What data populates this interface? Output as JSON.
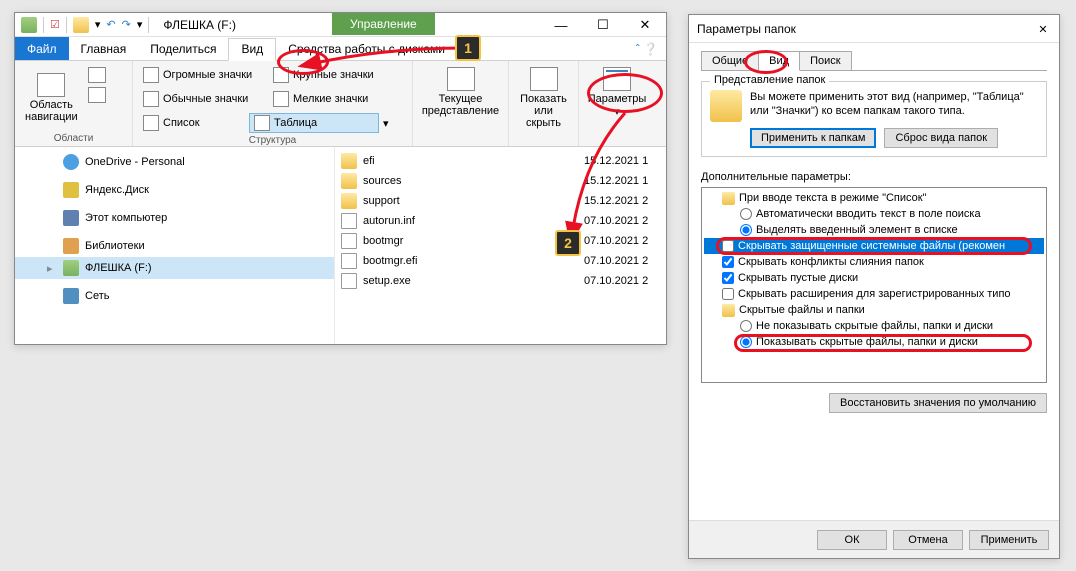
{
  "explorer": {
    "title": "ФЛЕШКА (F:)",
    "manage": "Управление",
    "win": {
      "min": "—",
      "max": "☐",
      "close": "✕"
    },
    "tabs": {
      "file": "Файл",
      "home": "Главная",
      "share": "Поделиться",
      "view": "Вид",
      "tools": "Средства работы с дисками"
    },
    "ribbon": {
      "panes": {
        "nav": "Область\nнавигации",
        "group": "Области"
      },
      "layout": {
        "huge": "Огромные значки",
        "large": "Крупные значки",
        "normal": "Обычные значки",
        "small": "Мелкие значки",
        "list": "Список",
        "table": "Таблица",
        "group": "Структура"
      },
      "current": {
        "label": "Текущее\nпредставление"
      },
      "showhide": {
        "label": "Показать\nили скрыть"
      },
      "params": {
        "label": "Параметры"
      }
    },
    "nav": [
      {
        "icon": "ico-cloud",
        "label": "OneDrive - Personal"
      },
      {
        "icon": "ico-yadisk",
        "label": "Яндекс.Диск"
      },
      {
        "icon": "ico-pc",
        "label": "Этот компьютер"
      },
      {
        "icon": "ico-lib",
        "label": "Библиотеки"
      },
      {
        "icon": "ico-disk",
        "label": "ФЛЕШКА (F:)",
        "selected": true
      },
      {
        "icon": "ico-net",
        "label": "Сеть"
      }
    ],
    "files": [
      {
        "icon": "ico-folder",
        "name": "efi",
        "date": "15.12.2021 1"
      },
      {
        "icon": "ico-folder",
        "name": "sources",
        "date": "15.12.2021 1"
      },
      {
        "icon": "ico-folder",
        "name": "support",
        "date": "15.12.2021 2"
      },
      {
        "icon": "ico-file",
        "name": "autorun.inf",
        "date": "07.10.2021 2"
      },
      {
        "icon": "ico-file",
        "name": "bootmgr",
        "date": "07.10.2021 2"
      },
      {
        "icon": "ico-file",
        "name": "bootmgr.efi",
        "date": "07.10.2021 2"
      },
      {
        "icon": "ico-file",
        "name": "setup.exe",
        "date": "07.10.2021 2"
      }
    ]
  },
  "dialog": {
    "title": "Параметры папок",
    "tabs": {
      "general": "Общие",
      "view": "Вид",
      "search": "Поиск"
    },
    "view_group": {
      "legend": "Представление папок",
      "text": "Вы можете применить этот вид (например, \"Таблица\" или \"Значки\") ко всем папкам такого типа.",
      "apply": "Применить к папкам",
      "reset": "Сброс вида папок"
    },
    "advanced_label": "Дополнительные параметры:",
    "tree": {
      "a": "При вводе текста в режиме \"Список\"",
      "a1": "Автоматически вводить текст в поле поиска",
      "a2": "Выделять введенный элемент в списке",
      "b": "Скрывать защищенные системные файлы (рекомен",
      "c": "Скрывать конфликты слияния папок",
      "d": "Скрывать пустые диски",
      "e": "Скрывать расширения для зарегистрированных типо",
      "f": "Скрытые файлы и папки",
      "f1": "Не показывать скрытые файлы, папки и диски",
      "f2": "Показывать скрытые файлы, папки и диски"
    },
    "restore": "Восстановить значения по умолчанию",
    "ok": "ОК",
    "cancel": "Отмена",
    "apply": "Применить"
  },
  "badges": {
    "one": "1",
    "two": "2"
  }
}
